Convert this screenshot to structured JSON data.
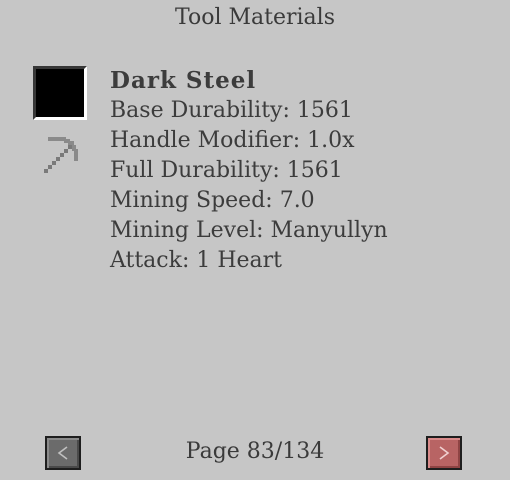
{
  "window": {
    "title": "Tool Materials"
  },
  "material": {
    "name": "Dark Steel",
    "swatch_color": "#000000",
    "icon": "pickaxe-icon",
    "stats": [
      "Base Durability: 1561",
      "Handle Modifier: 1.0x",
      "Full Durability: 1561",
      "Mining Speed: 7.0",
      "Mining Level: Manyullyn",
      "Attack: 1 Heart"
    ]
  },
  "pagination": {
    "page_label": "Page 83/134",
    "prev_icon": "chevron-left-icon",
    "next_icon": "chevron-right-icon"
  },
  "colors": {
    "background": "#c6c6c6",
    "text": "#3c3c3c",
    "prev_button": "#6b6b6b",
    "next_button": "#b86464"
  }
}
